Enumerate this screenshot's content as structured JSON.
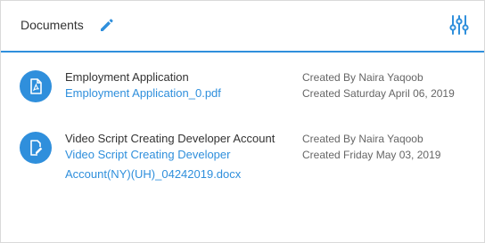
{
  "header": {
    "title": "Documents",
    "accent_color": "#2f8fdc",
    "edit_icon": "pencil-icon",
    "filter_icon": "sliders-icon"
  },
  "documents": [
    {
      "name": "Employment Application",
      "file": "Employment Application_0.pdf",
      "created_by": "Created By Naira Yaqoob",
      "created_on": "Created Saturday April 06, 2019",
      "icon": "pdf-file-icon"
    },
    {
      "name": "Video Script Creating Developer Account",
      "file": "Video Script Creating Developer Account(NY)(UH)_04242019.docx",
      "created_by": "Created By Naira Yaqoob",
      "created_on": "Created Friday May 03, 2019",
      "icon": "edit-file-icon"
    }
  ]
}
